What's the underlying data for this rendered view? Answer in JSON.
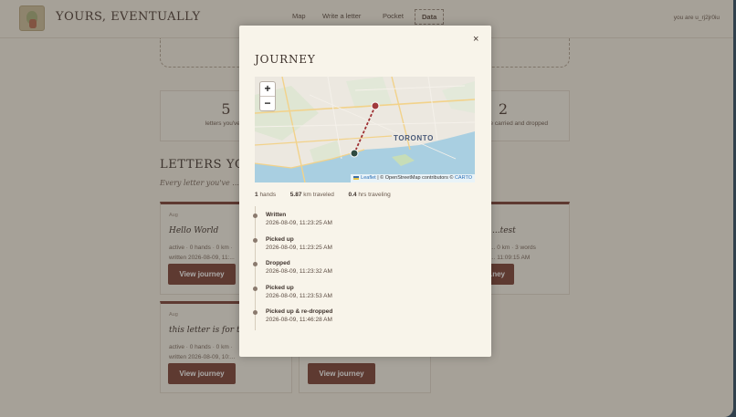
{
  "header": {
    "brand": "YOURS, EVENTUALLY",
    "nav": [
      "Map",
      "Write a letter",
      "Pocket",
      "Data"
    ],
    "user": "you are u_rj2jr0iu"
  },
  "stats": [
    {
      "value": "5",
      "label": "letters you've ..."
    },
    {
      "value": "2",
      "label": "letters you've carried and dropped"
    }
  ],
  "letters_section": {
    "title": "LETTERS YOU'...",
    "subtitle": "Every letter you've ..."
  },
  "letter_cards": [
    {
      "date": "Aug",
      "title": "Hello World",
      "meta1": "active · 0 hands · 0 km ·",
      "meta2": "written 2026-08-09, 11:...",
      "button": "View journey"
    },
    {
      "date": "",
      "title": "...test",
      "meta1": "... 0 km · 3 words",
      "meta2": "... 11:09:15 AM",
      "button": "...ney"
    },
    {
      "date": "Aug",
      "title": "this letter is for te...",
      "meta1": "active · 0 hands · 0 km ·",
      "meta2": "written 2026-08-09, 10:...",
      "button": "View journey"
    },
    {
      "date": "",
      "title": "",
      "meta1": "",
      "meta2": "",
      "button": "View journey"
    }
  ],
  "modal": {
    "title": "JOURNEY",
    "close_label": "×",
    "map": {
      "city_label": "TORONTO",
      "zoom_in": "+",
      "zoom_out": "−",
      "attribution_leaflet": "Leaflet",
      "attribution_text": " | © OpenStreetMap contributors © ",
      "attribution_carto": "CARTO"
    },
    "journey_stats": {
      "hands_value": "1",
      "hands_label": "hands",
      "km_value": "5.87",
      "km_label": "km traveled",
      "hrs_value": "0.4",
      "hrs_label": "hrs traveling"
    },
    "timeline": [
      {
        "event": "Written",
        "time": "2026-08-09, 11:23:25 AM"
      },
      {
        "event": "Picked up",
        "time": "2026-08-09, 11:23:25 AM"
      },
      {
        "event": "Dropped",
        "time": "2026-08-09, 11:23:32 AM"
      },
      {
        "event": "Picked up",
        "time": "2026-08-09, 11:23:53 AM"
      },
      {
        "event": "Picked up & re-dropped",
        "time": "2026-08-09, 11:46:28 AM"
      }
    ]
  },
  "colors": {
    "accent": "#7b4035",
    "background": "#f6f1e6",
    "route": "#9e2f32",
    "start_marker": "#2f4a3f",
    "end_marker": "#a13a3c"
  }
}
